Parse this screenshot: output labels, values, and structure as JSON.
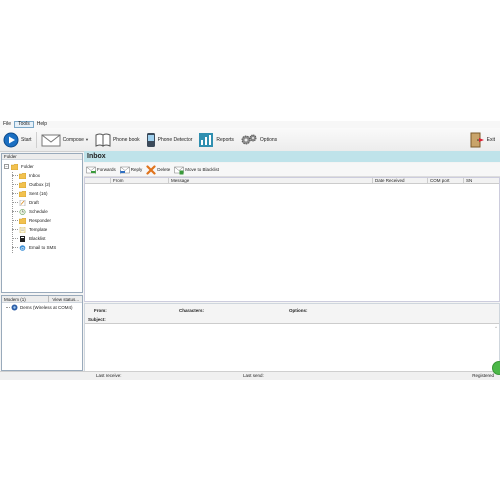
{
  "menu": {
    "items": [
      "File",
      "Tools",
      "Help"
    ]
  },
  "toolbar": {
    "start": "Start",
    "compose": "Compose",
    "phone_book": "Phone book",
    "phone_detector": "Phone Detector",
    "reports": "Reports",
    "options": "Options",
    "exit": "Exit"
  },
  "folder_panel": {
    "header": "Folder",
    "root": "Folder",
    "items": [
      "Inbox",
      "Outbox (2)",
      "Sent (16)",
      "Draft",
      "Schedule",
      "Responder",
      "Template",
      "Blacklist",
      "Email to SMS"
    ]
  },
  "modem_panel": {
    "header": "Modem (1)",
    "view_status": "View status...",
    "device": "Dems (Wireless at COM4)"
  },
  "inbox": {
    "title": "Inbox",
    "actions": {
      "forward": "Forwards",
      "reply": "Reply",
      "delete": "Delete",
      "move": "Move to Blacklist"
    },
    "columns": [
      "",
      "From",
      "Message",
      "Date Received",
      "COM port",
      "SN"
    ]
  },
  "preview": {
    "from": "From:",
    "characters": "Characters:",
    "options": "Options:",
    "subject": "Subject:"
  },
  "status": {
    "last_receive": "Last receive:",
    "last_send": "Last send:",
    "registered": "Registered"
  },
  "colors": {
    "accent": "#bfe3ea",
    "folder": "#f2c14e",
    "start_icon": "#1a6fc2"
  }
}
